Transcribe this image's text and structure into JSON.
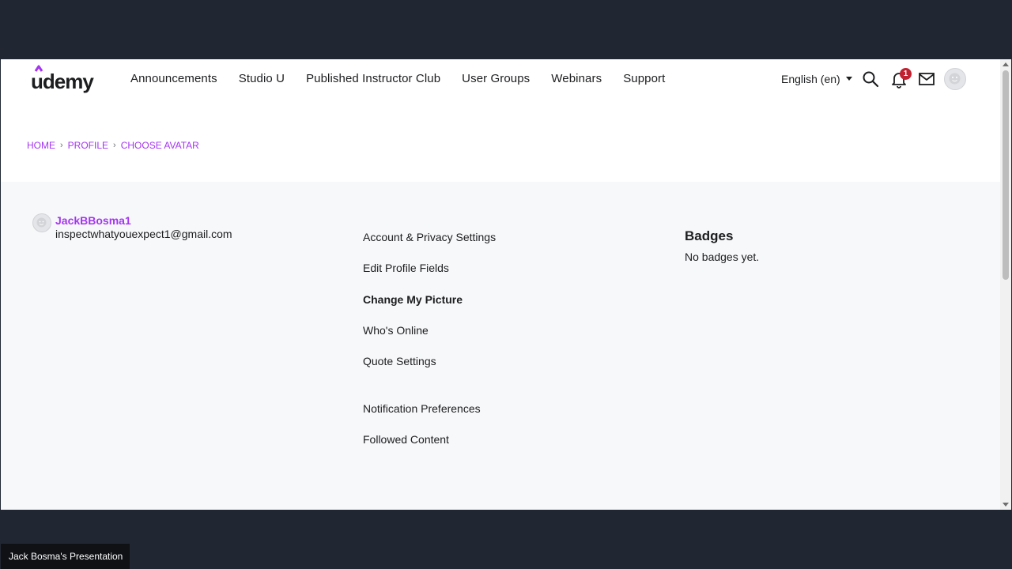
{
  "header": {
    "logo_text": "udemy",
    "nav": [
      "Announcements",
      "Studio U",
      "Published Instructor Club",
      "User Groups",
      "Webinars",
      "Support"
    ],
    "language": "English (en)",
    "notification_count": "1"
  },
  "breadcrumb": [
    "HOME",
    "PROFILE",
    "CHOOSE AVATAR"
  ],
  "profile": {
    "username": "JackBBosma1",
    "email": "inspectwhatyouexpect1@gmail.com"
  },
  "menu": [
    {
      "label": "Account & Privacy Settings",
      "active": false
    },
    {
      "label": "Edit Profile Fields",
      "active": false
    },
    {
      "label": "Change My Picture",
      "active": true
    },
    {
      "label": "Who's Online",
      "active": false
    },
    {
      "label": "Quote Settings",
      "active": false
    },
    {
      "label": "Notification Preferences",
      "active": false
    },
    {
      "label": "Followed Content",
      "active": false
    }
  ],
  "badges": {
    "title": "Badges",
    "empty_text": "No badges yet."
  },
  "presenter_label": "Jack Bosma's Presentation",
  "colors": {
    "accent": "#a435f0",
    "badge": "#c0202f",
    "frame": "#212732"
  }
}
